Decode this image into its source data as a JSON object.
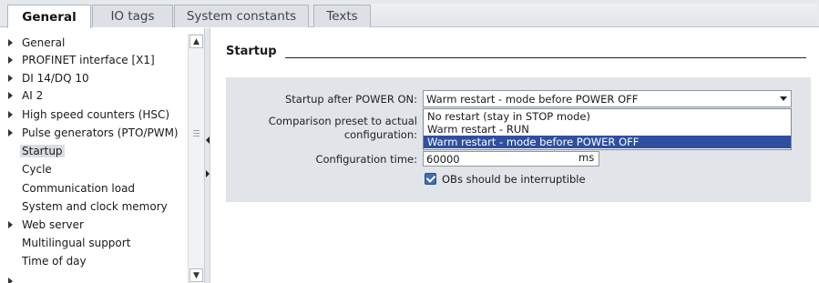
{
  "tabs": [
    {
      "label": "General",
      "active": true
    },
    {
      "label": "IO tags",
      "active": false
    },
    {
      "label": "System constants",
      "active": false
    },
    {
      "label": "Texts",
      "active": false
    }
  ],
  "nav": {
    "items": [
      {
        "label": "General",
        "expandable": true
      },
      {
        "label": "PROFINET interface [X1]",
        "expandable": true
      },
      {
        "label": "DI 14/DQ 10",
        "expandable": true
      },
      {
        "label": "AI 2",
        "expandable": true
      },
      {
        "label": "High speed counters (HSC)",
        "expandable": true
      },
      {
        "label": "Pulse generators (PTO/PWM)",
        "expandable": true
      },
      {
        "label": "Startup",
        "expandable": false,
        "selected": true
      },
      {
        "label": "Cycle",
        "expandable": false
      },
      {
        "label": "Communication load",
        "expandable": false
      },
      {
        "label": "System and clock memory",
        "expandable": false
      },
      {
        "label": "Web server",
        "expandable": true
      },
      {
        "label": "Multilingual support",
        "expandable": false
      },
      {
        "label": "Time of day",
        "expandable": false
      }
    ]
  },
  "section": {
    "title": "Startup"
  },
  "form": {
    "startup_label": "Startup after POWER ON:",
    "startup_value": "Warm restart - mode before POWER OFF",
    "startup_options": [
      "No restart (stay in STOP mode)",
      "Warm restart - RUN",
      "Warm restart - mode before POWER OFF"
    ],
    "selected_option_index": 2,
    "comparison_label_line1": "Comparison preset to actual",
    "comparison_label_line2": "configuration:",
    "config_time_label": "Configuration time:",
    "config_time_value": "60000",
    "config_time_unit": "ms",
    "obs_interruptible_label": "OBs should be interruptible",
    "obs_interruptible_checked": true
  },
  "colors": {
    "selection": "#2f4fa0",
    "panel_bg": "#e1e4e8",
    "tab_bar": "#e6e9ec"
  }
}
